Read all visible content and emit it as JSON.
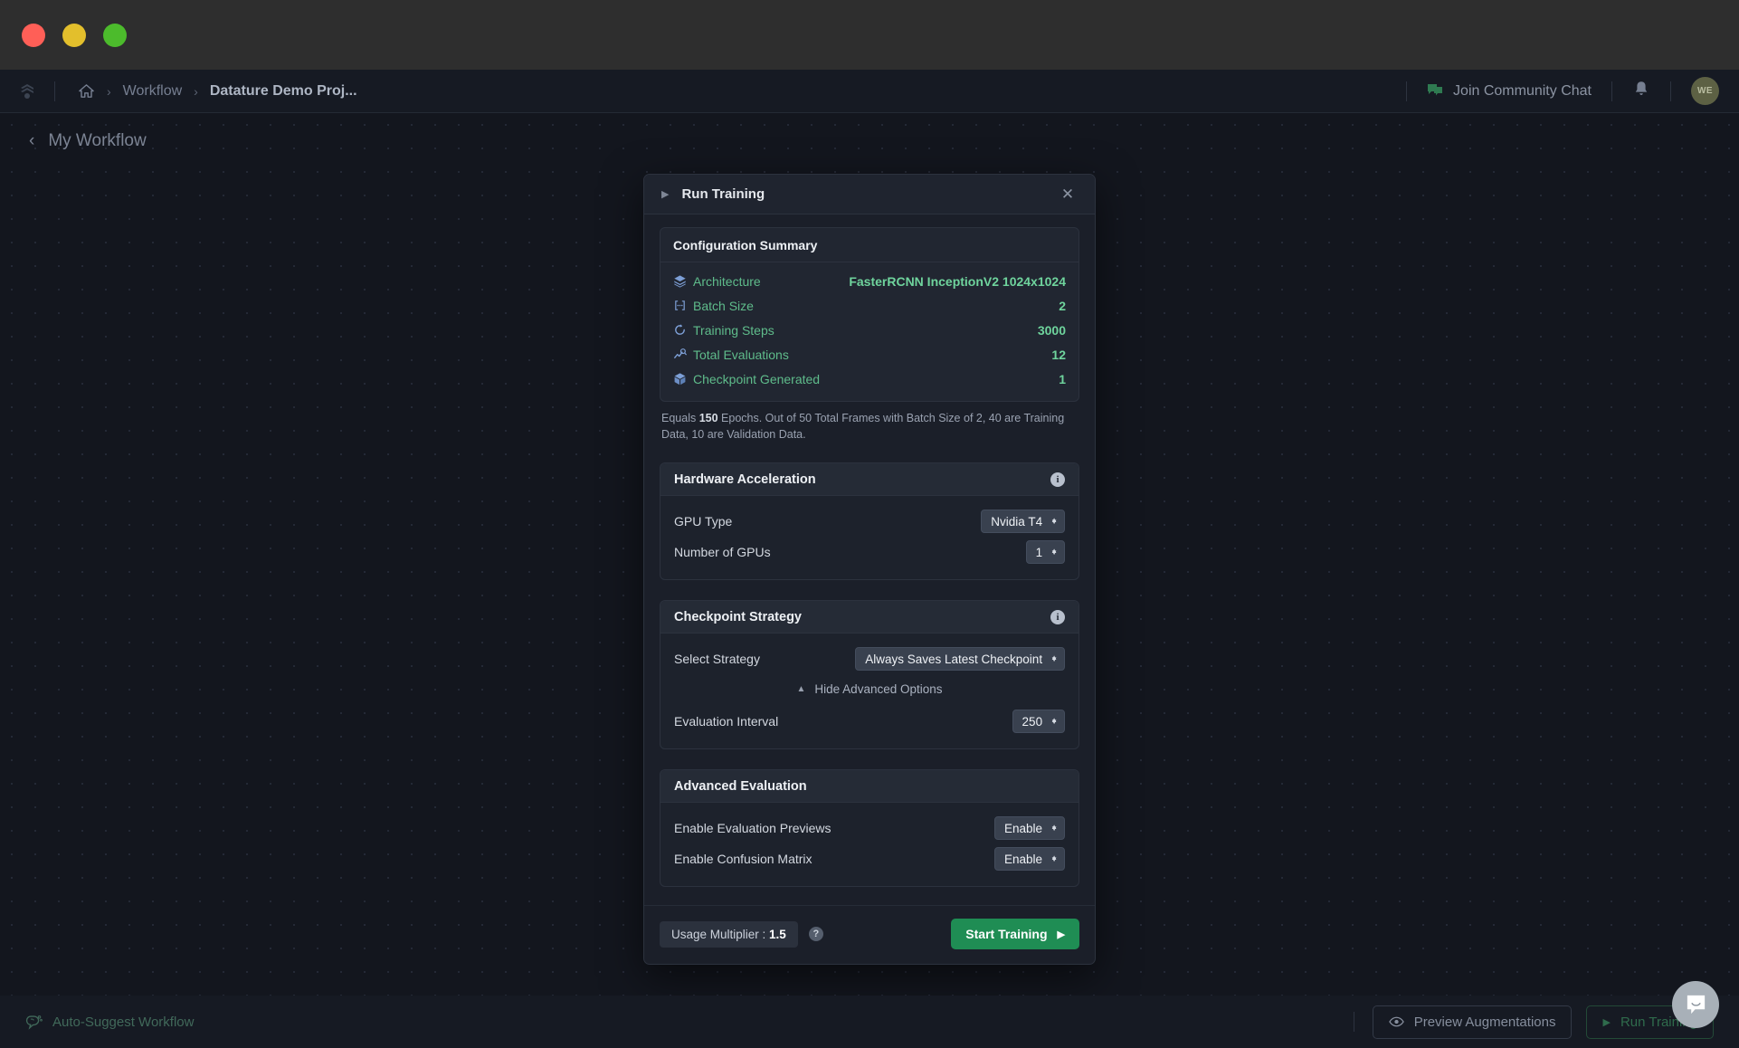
{
  "window": {
    "traffic_lights": [
      "close",
      "minimize",
      "maximize"
    ],
    "colors": {
      "close": "#ff5f57",
      "minimize": "#e3bf2c",
      "maximize": "#4cbb2c"
    }
  },
  "topnav": {
    "logo_icon": "datature-logo-icon",
    "home_icon": "home-icon",
    "breadcrumb": [
      {
        "label": "Workflow",
        "current": false
      },
      {
        "label": "Datature Demo Proj...",
        "current": true
      }
    ],
    "separator": ">",
    "community": {
      "label": "Join Community Chat",
      "icon": "chat-bubble-icon",
      "color": "#2f7a51"
    },
    "notifications_icon": "bell-icon",
    "avatar_initials": "WE"
  },
  "canvas": {
    "back_link": {
      "label": "My Workflow",
      "icon": "chevron-left-icon"
    }
  },
  "modal": {
    "title": "Run Training",
    "play_icon": "play-triangle-icon",
    "close_icon": "close-icon",
    "summary": {
      "title": "Configuration Summary",
      "rows": [
        {
          "icon": "layers-icon",
          "label": "Architecture",
          "value": "FasterRCNN InceptionV2 1024x1024"
        },
        {
          "icon": "batch-brackets-icon",
          "label": "Batch Size",
          "value": "2"
        },
        {
          "icon": "refresh-icon",
          "label": "Training Steps",
          "value": "3000"
        },
        {
          "icon": "chart-search-icon",
          "label": "Total Evaluations",
          "value": "12"
        },
        {
          "icon": "cube-icon",
          "label": "Checkpoint Generated",
          "value": "1"
        }
      ],
      "note_prefix": "Equals ",
      "note_bold": "150",
      "note_suffix": " Epochs. Out of 50 Total Frames with Batch Size of 2, 40 are Training Data, 10 are Validation Data."
    },
    "hardware": {
      "title": "Hardware Acceleration",
      "info_icon": "info-icon",
      "fields": [
        {
          "label": "GPU Type",
          "value": "Nvidia T4"
        },
        {
          "label": "Number of GPUs",
          "value": "1"
        }
      ]
    },
    "checkpoint": {
      "title": "Checkpoint Strategy",
      "info_icon": "info-icon",
      "strategy_label": "Select Strategy",
      "strategy_value": "Always Saves Latest Checkpoint",
      "advanced_toggle": "Hide Advanced Options",
      "interval_label": "Evaluation Interval",
      "interval_value": "250"
    },
    "advanced_eval": {
      "title": "Advanced Evaluation",
      "fields": [
        {
          "label": "Enable Evaluation Previews",
          "value": "Enable"
        },
        {
          "label": "Enable Confusion Matrix",
          "value": "Enable"
        }
      ]
    },
    "footer": {
      "usage_label": "Usage Multiplier : ",
      "usage_value": "1.5",
      "help_icon": "question-mark-icon",
      "start_label": "Start Training",
      "start_color": "#1f8d54"
    }
  },
  "bottombar": {
    "auto_suggest": {
      "label": "Auto-Suggest Workflow",
      "icon": "brain-icon"
    },
    "preview_label": "Preview Augmentations",
    "preview_icon": "eye-icon",
    "run_label": "Run Training",
    "run_icon": "play-triangle-icon",
    "chat_icon": "chat-smile-icon"
  }
}
